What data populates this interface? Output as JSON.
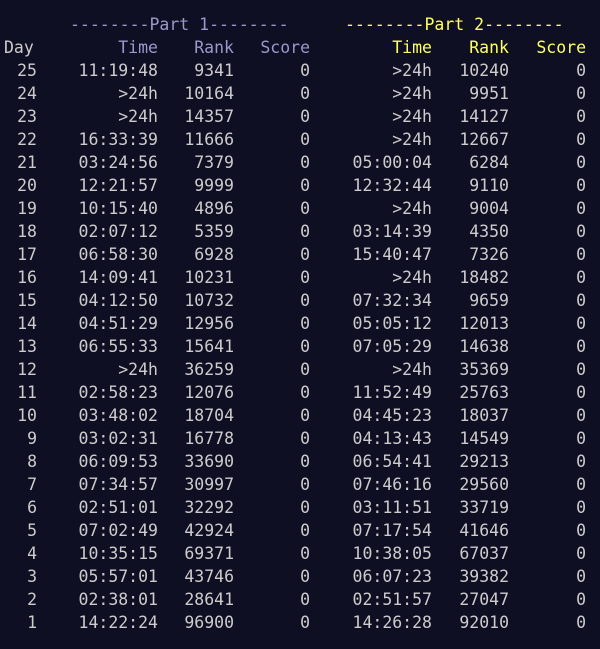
{
  "header": {
    "part1": "--------Part 1--------",
    "part2": "--------Part 2--------"
  },
  "columns": {
    "day": "Day",
    "time": "Time",
    "rank": "Rank",
    "score": "Score"
  },
  "rows": [
    {
      "day": "25",
      "t1": "11:19:48",
      "r1": "9341",
      "s1": "0",
      "t2": ">24h",
      "r2": "10240",
      "s2": "0"
    },
    {
      "day": "24",
      "t1": ">24h",
      "r1": "10164",
      "s1": "0",
      "t2": ">24h",
      "r2": "9951",
      "s2": "0"
    },
    {
      "day": "23",
      "t1": ">24h",
      "r1": "14357",
      "s1": "0",
      "t2": ">24h",
      "r2": "14127",
      "s2": "0"
    },
    {
      "day": "22",
      "t1": "16:33:39",
      "r1": "11666",
      "s1": "0",
      "t2": ">24h",
      "r2": "12667",
      "s2": "0"
    },
    {
      "day": "21",
      "t1": "03:24:56",
      "r1": "7379",
      "s1": "0",
      "t2": "05:00:04",
      "r2": "6284",
      "s2": "0"
    },
    {
      "day": "20",
      "t1": "12:21:57",
      "r1": "9999",
      "s1": "0",
      "t2": "12:32:44",
      "r2": "9110",
      "s2": "0"
    },
    {
      "day": "19",
      "t1": "10:15:40",
      "r1": "4896",
      "s1": "0",
      "t2": ">24h",
      "r2": "9004",
      "s2": "0"
    },
    {
      "day": "18",
      "t1": "02:07:12",
      "r1": "5359",
      "s1": "0",
      "t2": "03:14:39",
      "r2": "4350",
      "s2": "0"
    },
    {
      "day": "17",
      "t1": "06:58:30",
      "r1": "6928",
      "s1": "0",
      "t2": "15:40:47",
      "r2": "7326",
      "s2": "0"
    },
    {
      "day": "16",
      "t1": "14:09:41",
      "r1": "10231",
      "s1": "0",
      "t2": ">24h",
      "r2": "18482",
      "s2": "0"
    },
    {
      "day": "15",
      "t1": "04:12:50",
      "r1": "10732",
      "s1": "0",
      "t2": "07:32:34",
      "r2": "9659",
      "s2": "0"
    },
    {
      "day": "14",
      "t1": "04:51:29",
      "r1": "12956",
      "s1": "0",
      "t2": "05:05:12",
      "r2": "12013",
      "s2": "0"
    },
    {
      "day": "13",
      "t1": "06:55:33",
      "r1": "15641",
      "s1": "0",
      "t2": "07:05:29",
      "r2": "14638",
      "s2": "0"
    },
    {
      "day": "12",
      "t1": ">24h",
      "r1": "36259",
      "s1": "0",
      "t2": ">24h",
      "r2": "35369",
      "s2": "0"
    },
    {
      "day": "11",
      "t1": "02:58:23",
      "r1": "12076",
      "s1": "0",
      "t2": "11:52:49",
      "r2": "25763",
      "s2": "0"
    },
    {
      "day": "10",
      "t1": "03:48:02",
      "r1": "18704",
      "s1": "0",
      "t2": "04:45:23",
      "r2": "18037",
      "s2": "0"
    },
    {
      "day": "9",
      "t1": "03:02:31",
      "r1": "16778",
      "s1": "0",
      "t2": "04:13:43",
      "r2": "14549",
      "s2": "0"
    },
    {
      "day": "8",
      "t1": "06:09:53",
      "r1": "33690",
      "s1": "0",
      "t2": "06:54:41",
      "r2": "29213",
      "s2": "0"
    },
    {
      "day": "7",
      "t1": "07:34:57",
      "r1": "30997",
      "s1": "0",
      "t2": "07:46:16",
      "r2": "29560",
      "s2": "0"
    },
    {
      "day": "6",
      "t1": "02:51:01",
      "r1": "32292",
      "s1": "0",
      "t2": "03:11:51",
      "r2": "33719",
      "s2": "0"
    },
    {
      "day": "5",
      "t1": "07:02:49",
      "r1": "42924",
      "s1": "0",
      "t2": "07:17:54",
      "r2": "41646",
      "s2": "0"
    },
    {
      "day": "4",
      "t1": "10:35:15",
      "r1": "69371",
      "s1": "0",
      "t2": "10:38:05",
      "r2": "67037",
      "s2": "0"
    },
    {
      "day": "3",
      "t1": "05:57:01",
      "r1": "43746",
      "s1": "0",
      "t2": "06:07:23",
      "r2": "39382",
      "s2": "0"
    },
    {
      "day": "2",
      "t1": "02:38:01",
      "r1": "28641",
      "s1": "0",
      "t2": "02:51:57",
      "r2": "27047",
      "s2": "0"
    },
    {
      "day": "1",
      "t1": "14:22:24",
      "r1": "96900",
      "s1": "0",
      "t2": "14:26:28",
      "r2": "92010",
      "s2": "0"
    }
  ],
  "colors": {
    "background": "#0f0f23",
    "text": "#cccccc",
    "part1": "#9999cc",
    "part2": "#ffff66"
  }
}
